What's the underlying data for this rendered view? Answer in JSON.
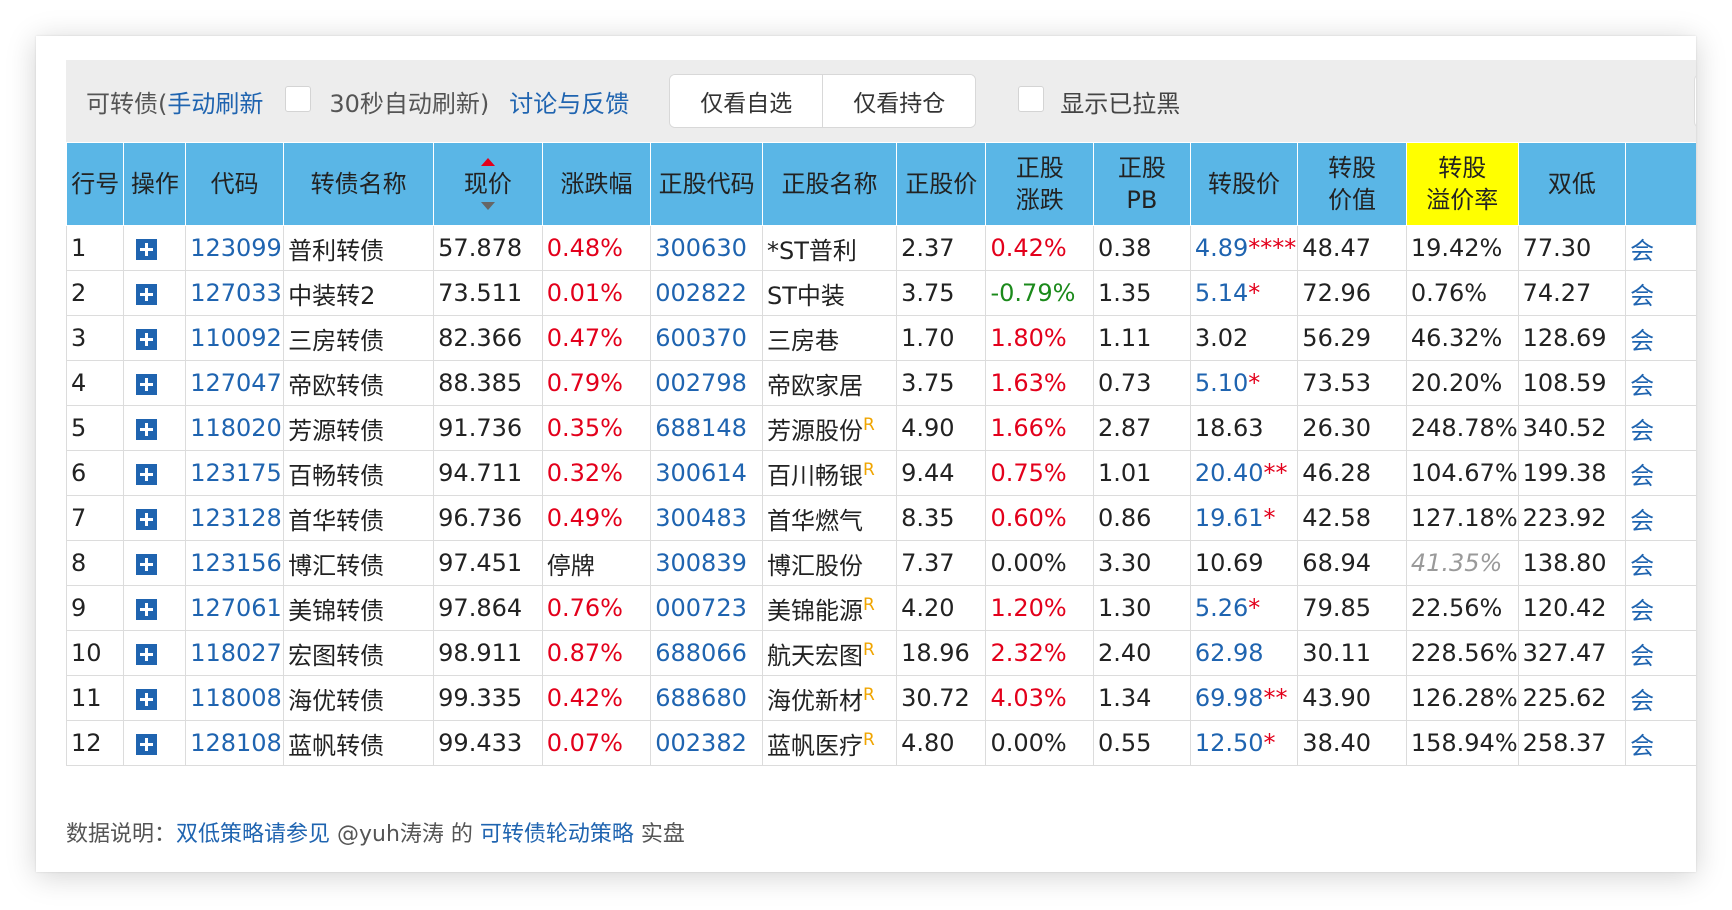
{
  "toolbar": {
    "title_prefix": "可转债(",
    "manual_refresh": "手动刷新",
    "auto_refresh": "30秒自动刷新)",
    "feedback": "讨论与反馈",
    "only_watchlist": "仅看自选",
    "only_holdings": "仅看持仓",
    "show_blacklisted": "显示已拉黑"
  },
  "columns": [
    {
      "key": "row",
      "label": "行号"
    },
    {
      "key": "op",
      "label": "操作"
    },
    {
      "key": "code",
      "label": "代码"
    },
    {
      "key": "name",
      "label": "转债名称"
    },
    {
      "key": "price",
      "label": "现价",
      "sorted": "desc"
    },
    {
      "key": "chg",
      "label": "涨跌幅"
    },
    {
      "key": "scode",
      "label": "正股代码"
    },
    {
      "key": "sname",
      "label": "正股名称"
    },
    {
      "key": "sprice",
      "label": "正股价"
    },
    {
      "key": "schg",
      "label": "正股\n涨跌"
    },
    {
      "key": "pb",
      "label": "正股\nPB"
    },
    {
      "key": "cvp",
      "label": "转股价"
    },
    {
      "key": "cvv",
      "label": "转股\n价值"
    },
    {
      "key": "prem",
      "label": "转股\n溢价率",
      "highlight": true
    },
    {
      "key": "dl",
      "label": "双低"
    }
  ],
  "rows": [
    {
      "row": "1",
      "code": "123099",
      "name": "普利转债",
      "price": "57.878",
      "chg": "0.48%",
      "chg_color": "red",
      "scode": "300630",
      "sname": "*ST普利",
      "r": false,
      "sprice": "2.37",
      "schg": "0.42%",
      "schg_color": "red",
      "pb": "0.38",
      "cvp": "4.89",
      "cvp_link": true,
      "cvp_star": "****",
      "cvv": "48.47",
      "prem": "19.42%",
      "prem_style": "normal",
      "dl": "77.30"
    },
    {
      "row": "2",
      "code": "127033",
      "name": "中装转2",
      "price": "73.511",
      "chg": "0.01%",
      "chg_color": "red",
      "scode": "002822",
      "sname": "ST中装",
      "r": false,
      "sprice": "3.75",
      "schg": "-0.79%",
      "schg_color": "green",
      "pb": "1.35",
      "cvp": "5.14",
      "cvp_link": true,
      "cvp_star": "*",
      "cvv": "72.96",
      "prem": "0.76%",
      "prem_style": "normal",
      "dl": "74.27"
    },
    {
      "row": "3",
      "code": "110092",
      "name": "三房转债",
      "price": "82.366",
      "chg": "0.47%",
      "chg_color": "red",
      "scode": "600370",
      "sname": "三房巷",
      "r": false,
      "sprice": "1.70",
      "schg": "1.80%",
      "schg_color": "red",
      "pb": "1.11",
      "cvp": "3.02",
      "cvp_link": false,
      "cvp_star": "",
      "cvv": "56.29",
      "prem": "46.32%",
      "prem_style": "normal",
      "dl": "128.69"
    },
    {
      "row": "4",
      "code": "127047",
      "name": "帝欧转债",
      "price": "88.385",
      "chg": "0.79%",
      "chg_color": "red",
      "scode": "002798",
      "sname": "帝欧家居",
      "r": false,
      "sprice": "3.75",
      "schg": "1.63%",
      "schg_color": "red",
      "pb": "0.73",
      "cvp": "5.10",
      "cvp_link": true,
      "cvp_star": "*",
      "cvv": "73.53",
      "prem": "20.20%",
      "prem_style": "normal",
      "dl": "108.59"
    },
    {
      "row": "5",
      "code": "118020",
      "name": "芳源转债",
      "price": "91.736",
      "chg": "0.35%",
      "chg_color": "red",
      "scode": "688148",
      "sname": "芳源股份",
      "r": true,
      "sprice": "4.90",
      "schg": "1.66%",
      "schg_color": "red",
      "pb": "2.87",
      "cvp": "18.63",
      "cvp_link": false,
      "cvp_star": "",
      "cvv": "26.30",
      "prem": "248.78%",
      "prem_style": "normal",
      "dl": "340.52"
    },
    {
      "row": "6",
      "code": "123175",
      "name": "百畅转债",
      "price": "94.711",
      "chg": "0.32%",
      "chg_color": "red",
      "scode": "300614",
      "sname": "百川畅银",
      "r": true,
      "sprice": "9.44",
      "schg": "0.75%",
      "schg_color": "red",
      "pb": "1.01",
      "cvp": "20.40",
      "cvp_link": true,
      "cvp_star": "**",
      "cvv": "46.28",
      "prem": "104.67%",
      "prem_style": "normal",
      "dl": "199.38"
    },
    {
      "row": "7",
      "code": "123128",
      "name": "首华转债",
      "price": "96.736",
      "chg": "0.49%",
      "chg_color": "red",
      "scode": "300483",
      "sname": "首华燃气",
      "r": false,
      "sprice": "8.35",
      "schg": "0.60%",
      "schg_color": "red",
      "pb": "0.86",
      "cvp": "19.61",
      "cvp_link": true,
      "cvp_star": "*",
      "cvv": "42.58",
      "prem": "127.18%",
      "prem_style": "normal",
      "dl": "223.92"
    },
    {
      "row": "8",
      "code": "123156",
      "name": "博汇转债",
      "price": "97.451",
      "chg": "停牌",
      "chg_color": "black",
      "scode": "300839",
      "sname": "博汇股份",
      "r": false,
      "sprice": "7.37",
      "schg": "0.00%",
      "schg_color": "black",
      "pb": "3.30",
      "cvp": "10.69",
      "cvp_link": false,
      "cvp_star": "",
      "cvv": "68.94",
      "prem": "41.35%",
      "prem_style": "grey",
      "dl": "138.80"
    },
    {
      "row": "9",
      "code": "127061",
      "name": "美锦转债",
      "price": "97.864",
      "chg": "0.76%",
      "chg_color": "red",
      "scode": "000723",
      "sname": "美锦能源",
      "r": true,
      "sprice": "4.20",
      "schg": "1.20%",
      "schg_color": "red",
      "pb": "1.30",
      "cvp": "5.26",
      "cvp_link": true,
      "cvp_star": "*",
      "cvv": "79.85",
      "prem": "22.56%",
      "prem_style": "normal",
      "dl": "120.42"
    },
    {
      "row": "10",
      "code": "118027",
      "name": "宏图转债",
      "price": "98.911",
      "chg": "0.87%",
      "chg_color": "red",
      "scode": "688066",
      "sname": "航天宏图",
      "r": true,
      "sprice": "18.96",
      "schg": "2.32%",
      "schg_color": "red",
      "pb": "2.40",
      "cvp": "62.98",
      "cvp_link": true,
      "cvp_star": "",
      "cvv": "30.11",
      "prem": "228.56%",
      "prem_style": "normal",
      "dl": "327.47"
    },
    {
      "row": "11",
      "code": "118008",
      "name": "海优转债",
      "price": "99.335",
      "chg": "0.42%",
      "chg_color": "red",
      "scode": "688680",
      "sname": "海优新材",
      "r": true,
      "sprice": "30.72",
      "schg": "4.03%",
      "schg_color": "red",
      "pb": "1.34",
      "cvp": "69.98",
      "cvp_link": true,
      "cvp_star": "**",
      "cvv": "43.90",
      "prem": "126.28%",
      "prem_style": "normal",
      "dl": "225.62"
    },
    {
      "row": "12",
      "code": "128108",
      "name": "蓝帆转债",
      "price": "99.433",
      "chg": "0.07%",
      "chg_color": "red",
      "scode": "002382",
      "sname": "蓝帆医疗",
      "r": true,
      "sprice": "4.80",
      "schg": "0.00%",
      "schg_color": "black",
      "pb": "0.55",
      "cvp": "12.50",
      "cvp_link": true,
      "cvp_star": "*",
      "cvv": "38.40",
      "prem": "158.94%",
      "prem_style": "normal",
      "dl": "258.37"
    }
  ],
  "r_mark": "R",
  "edge_glyph": "会",
  "footer": {
    "prefix": "数据说明：",
    "link1": "双低策略请参见",
    "mid": " @yuh涛涛 的 ",
    "link2": "可转债轮动策略",
    "suffix": " 实盘"
  },
  "colors": {
    "header_bg": "#5ab6e6",
    "highlight_header": "#ffff00",
    "link": "#1f64b0",
    "up": "#e3001b",
    "down": "#1b8a1b"
  }
}
